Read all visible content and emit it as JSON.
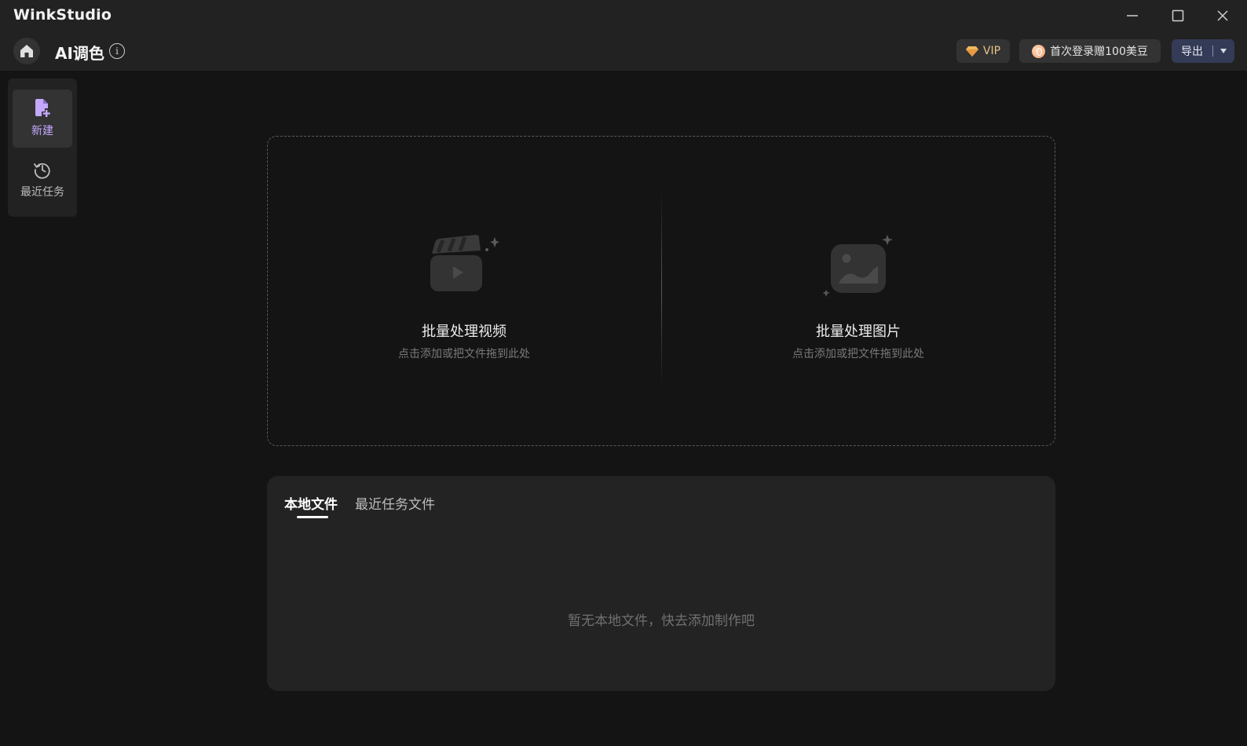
{
  "app": {
    "name": "WinkStudio"
  },
  "window_controls": {
    "minimize_icon": "minimize-icon",
    "maximize_icon": "maximize-icon",
    "close_icon": "close-icon"
  },
  "header": {
    "page_title": "AI调色",
    "info_icon_glyph": "i",
    "vip_label": "VIP",
    "promo_label": "首次登录赠100美豆",
    "export_label": "导出"
  },
  "sidebar": {
    "items": [
      {
        "label": "新建",
        "icon": "new-file-icon",
        "active": true
      },
      {
        "label": "最近任务",
        "icon": "history-icon",
        "active": false
      }
    ]
  },
  "dropzone": {
    "video": {
      "title": "批量处理视频",
      "hint": "点击添加或把文件拖到此处",
      "icon": "video-clapper-icon"
    },
    "image": {
      "title": "批量处理图片",
      "hint": "点击添加或把文件拖到此处",
      "icon": "image-icon"
    }
  },
  "files": {
    "tabs": [
      {
        "label": "本地文件",
        "active": true
      },
      {
        "label": "最近任务文件",
        "active": false
      }
    ],
    "empty_message": "暂无本地文件，快去添加制作吧"
  },
  "colors": {
    "titlebar_bg": "#222222",
    "body_bg": "#141414",
    "accent_purple": "#c4a8ff",
    "vip_gold": "#e8c48a",
    "export_bg": "#343b57"
  }
}
